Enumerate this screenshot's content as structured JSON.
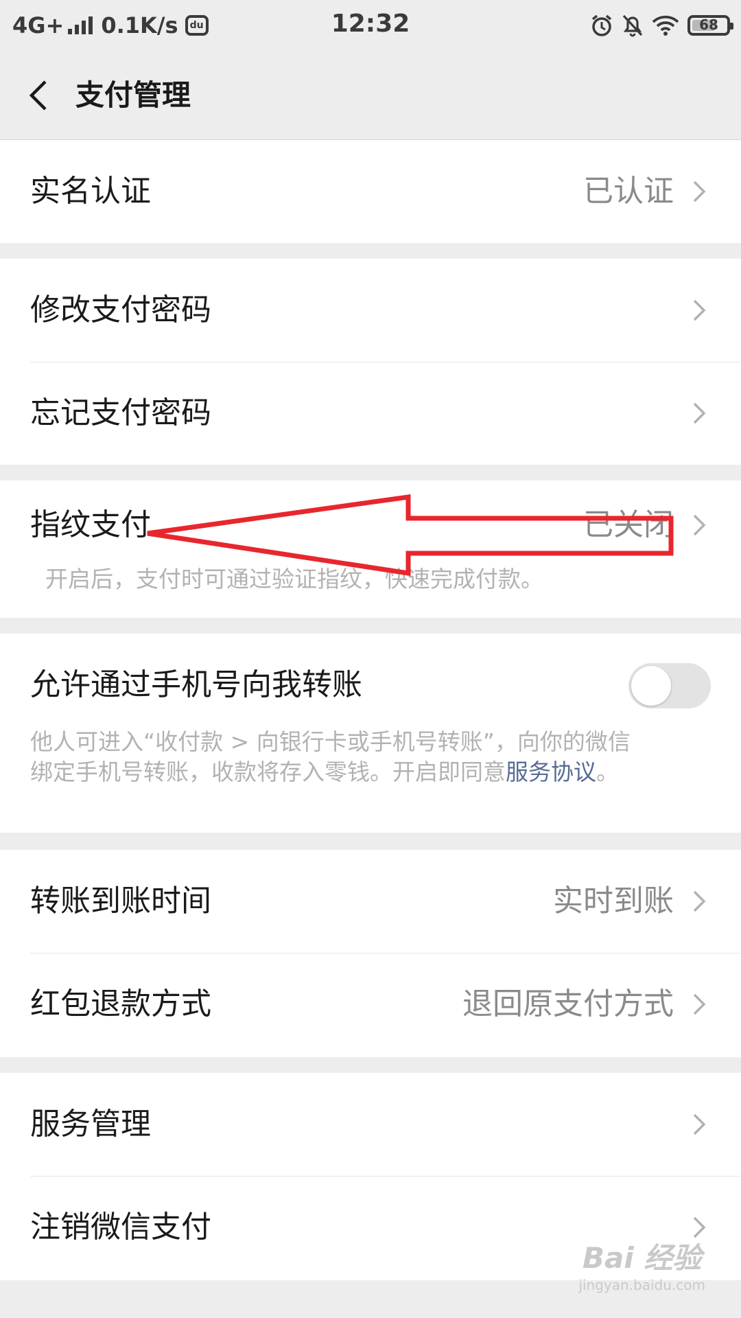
{
  "status_bar": {
    "network": "4G+",
    "speed": "0.1K/s",
    "du_glyph": "du",
    "time": "12:32",
    "battery": "68",
    "battery_level": 0.68,
    "icons": [
      "alarm-icon",
      "bell-off-icon",
      "wifi-icon",
      "battery-icon"
    ]
  },
  "nav": {
    "back_icon": "back-chevron-icon",
    "title": "支付管理"
  },
  "sections": {
    "verification": {
      "label": "实名认证",
      "value": "已认证"
    },
    "change_password": {
      "label": "修改支付密码"
    },
    "forgot_password": {
      "label": "忘记支付密码"
    },
    "fingerprint": {
      "label": "指纹支付",
      "value": "已关闭",
      "note": "开启后，支付时可通过验证指纹，快速完成付款。"
    },
    "phone_transfer": {
      "label": "允许通过手机号向我转账",
      "toggle_on": false,
      "note_line1": "他人可进入“收付款 > 向银行卡或手机号转账”，向你的微信",
      "note_line2": "绑定手机号转账，收款将存入零钱。开启即同意",
      "note_link": "服务协议",
      "note_end": "。"
    },
    "transfer_time": {
      "label": "转账到账时间",
      "value": "实时到账"
    },
    "refund": {
      "label": "红包退款方式",
      "value": "退回原支付方式"
    },
    "service": {
      "label": "服务管理"
    },
    "cancel_pay": {
      "label": "注销微信支付"
    }
  },
  "annotation": {
    "color": "#e8262d",
    "shape": "arrow"
  },
  "watermark": {
    "logo": "Bai 经验",
    "url": "jingyan.baidu.com"
  },
  "colors": {
    "background": "#ededed",
    "link": "#576b95",
    "note": "#b2b2b2",
    "value": "#8a8a8a"
  }
}
